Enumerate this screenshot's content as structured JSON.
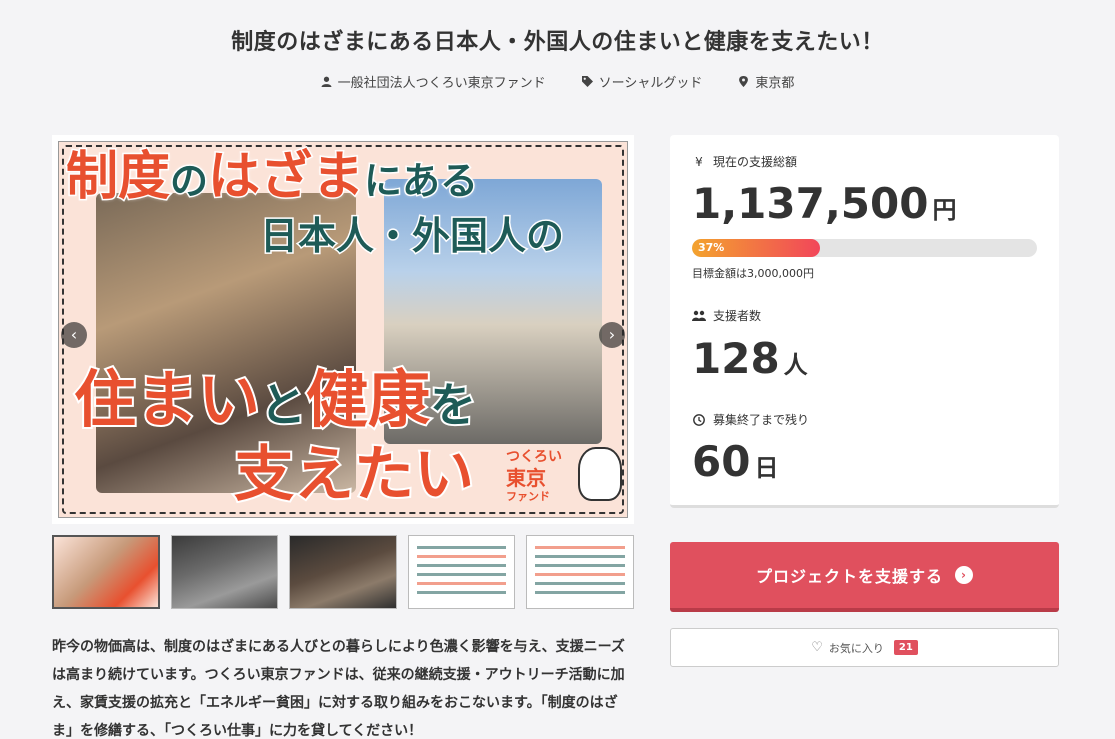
{
  "page": {
    "title": "制度のはざまにある日本人・外国人の住まいと健康を支えたい！"
  },
  "meta": {
    "organization": "一般社団法人つくろい東京ファンド",
    "category": "ソーシャルグッド",
    "location": "東京都",
    "icons": [
      "user-icon",
      "tag-icon",
      "map-pin-icon"
    ]
  },
  "hero": {
    "line1_a": "制度",
    "line1_b": "の",
    "line1_c": "はざま",
    "line1_d": "にある",
    "line2": "日本人・外国人の",
    "line3_a": "住まい",
    "line3_b": "と",
    "line3_c": "健康",
    "line3_d": "を",
    "line4": "支えたい",
    "logo_line1": "つくろい",
    "logo_line2": "東京",
    "logo_line3": "ファンド",
    "prev_icon": "‹",
    "next_icon": "›"
  },
  "thumbnails": {
    "count": 5,
    "active_index": 0
  },
  "description": {
    "text": "昨今の物価高は、制度のはざまにある人びとの暮らしにより色濃く影響を与え、支援ニーズは高まり続けています。つくろい東京ファンドは、従来の継続支援・アウトリーチ活動に加え、家賃支援の拡充と「エネルギー貧困」に対する取り組みをおこないます。「制度のはざま」を修繕する、「つくろい仕事」に力を貸してください！"
  },
  "stats": {
    "total_label": "現在の支援総額",
    "total_icon": "¥",
    "total_value": "1,137,500",
    "total_unit": "円",
    "progress_percent": 37,
    "progress_label": "37%",
    "goal_text": "目標金額は3,000,000円",
    "supporters_label": "支援者数",
    "supporters_value": "128",
    "supporters_unit": "人",
    "remaining_label": "募集終了まで残り",
    "remaining_value": "60",
    "remaining_unit": "日"
  },
  "actions": {
    "support_label": "プロジェクトを支援する",
    "favorite_label": "お気に入り",
    "favorite_count": "21"
  },
  "colors": {
    "accent": "#e0505e",
    "progress_start": "#f3a32e",
    "progress_end": "#f2465a",
    "hero_orange": "#e8502f",
    "hero_green": "#1e5b57",
    "background": "#f4f4f6"
  }
}
